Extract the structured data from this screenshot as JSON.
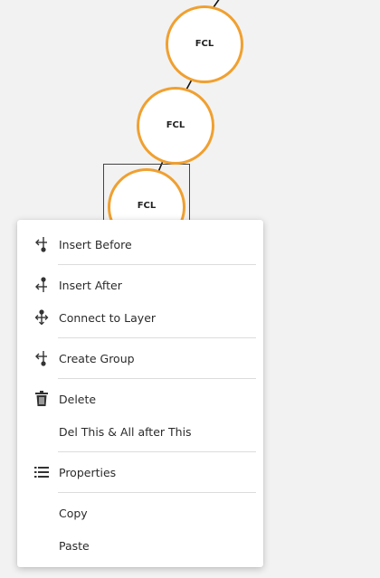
{
  "graph": {
    "nodes": [
      {
        "id": "node-1",
        "label": "FCL"
      },
      {
        "id": "node-2",
        "label": "FCL"
      },
      {
        "id": "node-3",
        "label": "FCL"
      }
    ],
    "node_stroke": "#f0a030",
    "node_fill": "#ffffff",
    "edge_color": "#111111"
  },
  "menu": {
    "items": [
      {
        "label": "Insert Before",
        "icon": "insert-before-icon"
      },
      {
        "label": "Insert After",
        "icon": "insert-after-icon"
      },
      {
        "label": "Connect to Layer",
        "icon": "connect-layer-icon"
      },
      {
        "label": "Create Group",
        "icon": "create-group-icon"
      },
      {
        "label": "Delete",
        "icon": "trash-icon"
      },
      {
        "label": "Del This & All after This",
        "icon": ""
      },
      {
        "label": "Properties",
        "icon": "list-icon"
      },
      {
        "label": "Copy",
        "icon": ""
      },
      {
        "label": "Paste",
        "icon": ""
      }
    ]
  }
}
